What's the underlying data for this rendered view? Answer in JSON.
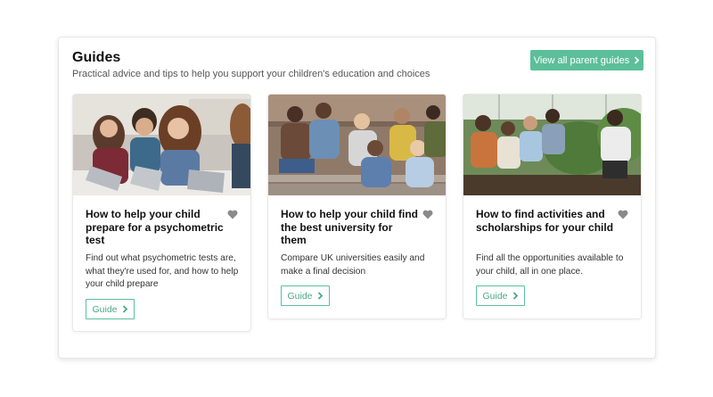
{
  "guides": {
    "title": "Guides",
    "subtitle": "Practical advice and tips to help you support your children's education and choices",
    "view_all_label": "View all parent guides",
    "cards": [
      {
        "title": "How to help your child prepare for a psychometric test",
        "description": "Find out what psychometric tests are, what they're used for, and how to help your child prepare",
        "button_label": "Guide",
        "image": "students-on-laptops-photo"
      },
      {
        "title": "How to help your child find the best university for them",
        "description": "Compare UK universities easily and make a final decision",
        "button_label": "Guide",
        "image": "students-sitting-on-steps-photo"
      },
      {
        "title": "How to find activities and scholarships for your child",
        "description": "Find all the opportunities available to your child, all in one place.",
        "button_label": "Guide",
        "image": "students-in-greenhouse-photo"
      }
    ]
  },
  "icons": {
    "chevron": "chevron-right-icon",
    "heart": "heart-icon"
  },
  "colors": {
    "accent": "#5cbf9a",
    "accent_text": "#4aa886",
    "heart": "#8a8a8a"
  }
}
